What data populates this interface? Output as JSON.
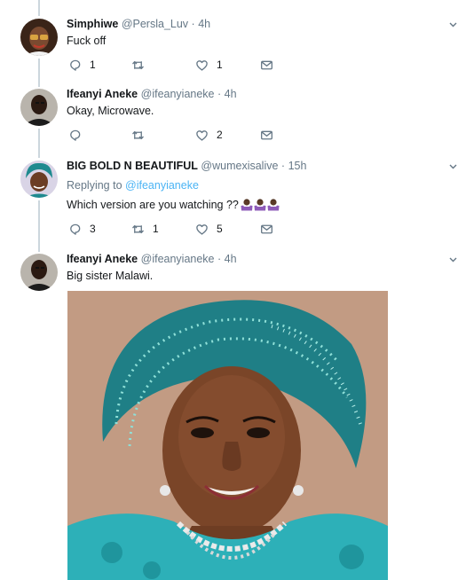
{
  "colors": {
    "link": "#1da1f2",
    "muted": "#657786",
    "text": "#14171a",
    "thread_line": "#ccd6dd"
  },
  "tweets": [
    {
      "name": "Simphiwe",
      "handle": "@Persla_Luv",
      "dot": "·",
      "time": "4h",
      "text": "Fuck off",
      "reply_count": "1",
      "retweet_count": "",
      "like_count": "1",
      "avatar": "avatar-photo-woman-glasses"
    },
    {
      "name": "Ifeanyi Aneke",
      "handle": "@ifeanyianeke",
      "dot": "·",
      "time": "4h",
      "text": "Okay, Microwave.",
      "reply_count": "",
      "retweet_count": "",
      "like_count": "2",
      "avatar": "avatar-photo-man"
    },
    {
      "name": "BIG BOLD N BEAUTIFUL",
      "handle": "@wumexisalive",
      "dot": "·",
      "time": "15h",
      "replying_prefix": "Replying to",
      "replying_to": "@ifeanyianeke",
      "text": "Which version are you watching ??",
      "emojis": [
        "person-shrugging-emoji",
        "person-shrugging-emoji",
        "person-shrugging-emoji"
      ],
      "reply_count": "3",
      "retweet_count": "1",
      "like_count": "5",
      "avatar": "avatar-photo-woman-gele"
    },
    {
      "name": "Ifeanyi Aneke",
      "handle": "@ifeanyianeke",
      "dot": "·",
      "time": "4h",
      "text": "Big sister Malawi.",
      "media": "photo-woman-teal-gele",
      "avatar": "avatar-photo-man"
    }
  ],
  "icons": [
    "reply-icon",
    "retweet-icon",
    "like-icon",
    "dm-icon",
    "chevron-down-icon"
  ]
}
